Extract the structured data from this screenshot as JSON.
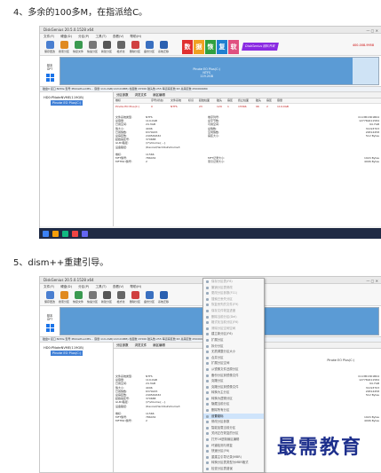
{
  "steps": [
    {
      "title": "4、多余的100多M，在指派给C。"
    },
    {
      "title": "5、dism++重建引导。"
    }
  ],
  "app": {
    "window_title": "DiskGenius 20.5.0.1528 x64",
    "menus": [
      "文件(F)",
      "硬盘(D)",
      "分区(P)",
      "工具(T)",
      "查看(V)",
      "帮助(H)"
    ],
    "toolbar": [
      "保存更改",
      "搜索分区",
      "恢复文件",
      "快速分区",
      "新建分区",
      "格式化",
      "删除分区",
      "备份分区",
      "系统迁移"
    ],
    "ad_text": "DiskGenius 团队开发",
    "ad_phone": "400-008-9958",
    "disk_label": [
      "基本",
      "GPT"
    ],
    "partition_name": "Pinote EO Plus(C:)",
    "partition_fs": "NTFS",
    "partition_size": "119.2GB",
    "info_line": "磁盘0 接口:NVMe  型号:PNotePlusCMS…  容量:119.2GB(122104MB)  柱面数:15566  磁头数:255  每道扇区数:63  总扇区数:250069680",
    "tree": {
      "disk": "HD0:PNoteNVME(119GB)",
      "partition": "Pinote EO Plus(C:)",
      "partition_highlight": "Pinote EO Plus(C:)"
    },
    "tabs": [
      "分区参数",
      "浏览文件",
      "扇区编辑"
    ],
    "table_headers": [
      "卷标",
      "序号(状态)",
      "文件系统",
      "标识",
      "起始柱面",
      "磁头",
      "扇区",
      "终止柱面",
      "磁头",
      "扇区",
      "容量"
    ],
    "table_row": [
      "Pinote EO Plus(C:)",
      "0",
      "NTFS",
      "",
      "23",
      "129",
      "1",
      "15566",
      "96",
      "2",
      "119.0GB"
    ],
    "props": [
      {
        "k": "文件系统类型:",
        "v": "NTFS",
        "k2": "卷序列号:",
        "v2": "0113B13D1B04"
      },
      {
        "k": "总容量:",
        "v": "119.0GB",
        "k2": "总字节数:",
        "v2": "127769411584"
      },
      {
        "k": "已用空间:",
        "v": "24.3GB",
        "k2": "可用空间:",
        "v2": "94.7GB"
      },
      {
        "k": "簇大小:",
        "v": "4096",
        "k2": "总簇数:",
        "v2": "31193703"
      },
      {
        "k": "已用簇数:",
        "v": "6379245",
        "k2": "空闲簇数:",
        "v2": "24814458"
      },
      {
        "k": "总扇区数:",
        "v": "249549632",
        "k2": "扇区大小:",
        "v2": "512 Bytes"
      },
      {
        "k": "起始扇区号:",
        "v": "370688",
        "k2": "",
        "v2": ""
      },
      {
        "k": "GUID路径:",
        "v": "\\\\?\\Volume{…}",
        "k2": "",
        "v2": ""
      },
      {
        "k": "设备路径:",
        "v": "\\Device\\HarddiskVolume3",
        "k2": "",
        "v2": ""
      },
      {
        "k": "",
        "v": "",
        "k2": "",
        "v2": ""
      },
      {
        "k": "卷标:",
        "v": "11566",
        "k2": "",
        "v2": ""
      },
      {
        "k": "MFT簇号:",
        "v": "786432",
        "k2": "MFT记录大小:",
        "v2": "1024 Bytes"
      },
      {
        "k": "MFTMirr簇号:",
        "v": "2",
        "k2": "索引记录大小:",
        "v2": "4096 Bytes"
      }
    ],
    "context_menu": [
      "保存分区表(F8)",
      "撤销分区表修改",
      "更改分区参数(F11)",
      "搜索已丢失分区",
      "恢复丢失的文件(F9)",
      "保存文件恢复进度",
      "删除当前分区(Del)",
      "格式化当前分区(F6)",
      "清除分区空闲空间",
      "建立新分区(F6)",
      "扩展分区",
      "拆分分区",
      "无损调整分区大小",
      "合并分区",
      "扩展分区空间",
      "从镜像文件还原分区",
      "备份分区到镜像文件",
      "克隆分区",
      "克隆分区到镜像文件",
      "转换为主分区",
      "转换为逻辑分区",
      "隐藏当前分区",
      "删除所有分区",
      "设置卷标",
      "修改分区参数",
      "智能加载当前分区",
      "关闭正在恢复的分区",
      "打开16进制扇区编辑",
      "坏道检测与修复",
      "快速分区(F6)",
      "重建主引导记录(MBR)",
      "转换分区表类型为MBR格式",
      "检查分区表错误"
    ],
    "context_highlight": "设置卷标"
  },
  "watermark": "最需教育",
  "colors": {
    "partition_fill": "#5b9bd5",
    "accent": "#3f7fd6",
    "ad_bg": "#8a2be2"
  }
}
